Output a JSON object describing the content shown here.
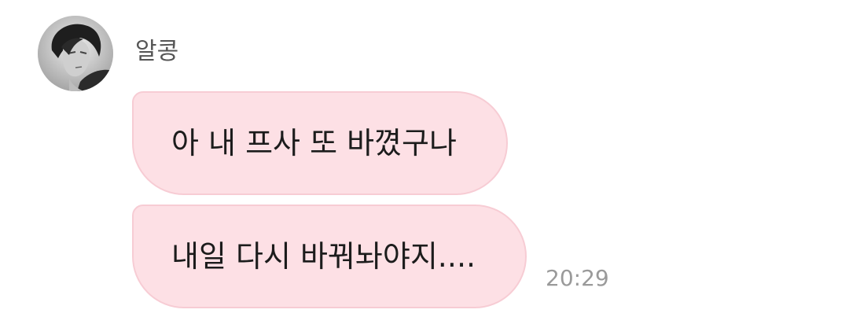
{
  "sender": {
    "name": "알콩",
    "avatar_icon": "profile-photo"
  },
  "messages": [
    {
      "text": "아 내 프사 또 바꼈구나"
    },
    {
      "text": "내일 다시 바꿔놔야지....",
      "time": "20:29"
    }
  ],
  "colors": {
    "bubble_background": "#fde0e5",
    "bubble_border": "#f7ccd4",
    "name_text": "#555555",
    "time_text": "#9a9a9a"
  }
}
